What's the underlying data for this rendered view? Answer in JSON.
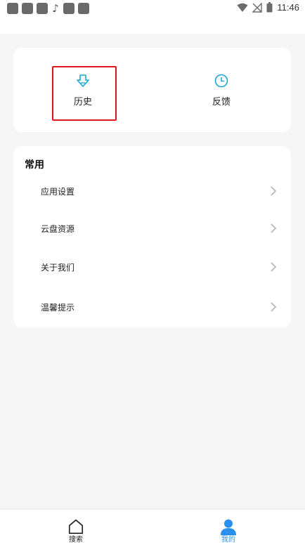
{
  "status_bar": {
    "time": "11:46",
    "left_icons": [
      "app-notification-icon",
      "app-notification-icon",
      "app-notification-icon",
      "music-note-icon",
      "app-notification-icon",
      "app-notification-icon"
    ],
    "right_icons": [
      "wifi-icon",
      "no-signal-icon",
      "battery-icon"
    ]
  },
  "shortcuts": {
    "history_label": "历史",
    "history_icon": "download-arrow-icon",
    "feedback_label": "反馈",
    "feedback_icon": "clock-icon"
  },
  "common_section": {
    "title": "常用",
    "items": [
      {
        "label": "应用设置"
      },
      {
        "label": "云盘资源"
      },
      {
        "label": "关于我们"
      },
      {
        "label": "温馨提示"
      }
    ]
  },
  "bottom_nav": {
    "tabs": [
      {
        "label": "搜索",
        "icon": "home-icon",
        "active": false
      },
      {
        "label": "我的",
        "icon": "person-icon",
        "active": true
      }
    ]
  },
  "colors": {
    "accent": "#2b8ff0",
    "icon_teal": "#1aa6d6",
    "highlight": "#e0161b",
    "background": "#f6f6f6"
  }
}
